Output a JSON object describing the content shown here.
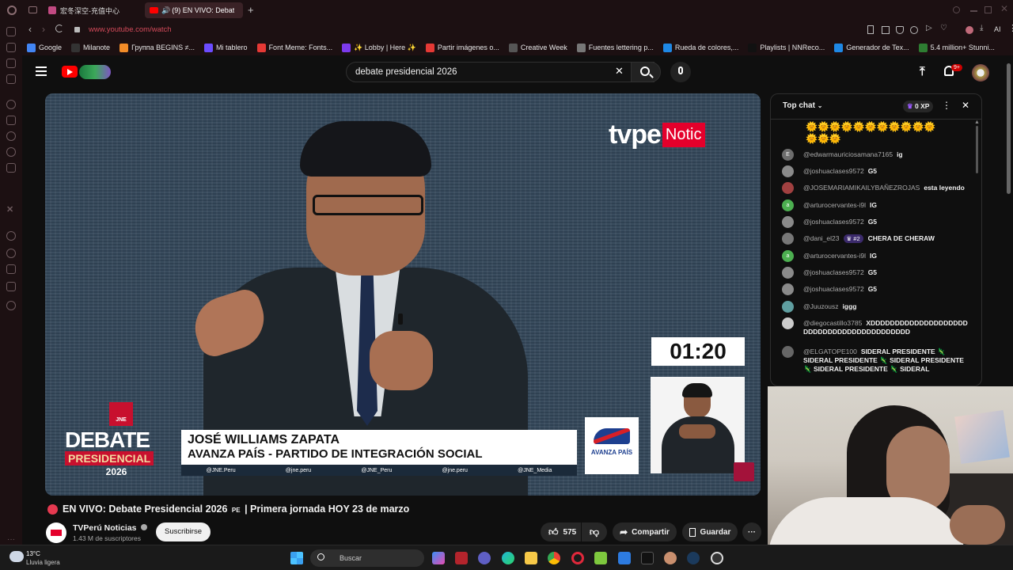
{
  "browser": {
    "tabs": [
      {
        "label": "宏冬深空-充值中心"
      },
      {
        "label": "(9)  EN VIVO: Debat"
      }
    ],
    "new_tab": "+",
    "address": "www.youtube.com/watch",
    "ai_label": "AI",
    "bookmarks": [
      {
        "label": "Google",
        "color": "#4285f4"
      },
      {
        "label": "Milanote",
        "color": "#333333"
      },
      {
        "label": "Группа BEGINS ≠...",
        "color": "#f28c28"
      },
      {
        "label": "Mi tablero",
        "color": "#6b4cff"
      },
      {
        "label": "Font Meme: Fonts...",
        "color": "#e53935"
      },
      {
        "label": "✨ Lobby | Here ✨",
        "color": "#7c3aed"
      },
      {
        "label": "Partir imágenes o...",
        "color": "#e53935"
      },
      {
        "label": "Creative Week",
        "color": "#555555"
      },
      {
        "label": "Fuentes lettering p...",
        "color": "#777777"
      },
      {
        "label": "Rueda de colores,...",
        "color": "#1e88e5"
      },
      {
        "label": "Playlists | NNReco...",
        "color": "#111111"
      },
      {
        "label": "Generador de Tex...",
        "color": "#1e88e5"
      },
      {
        "label": "5.4 million+ Stunni...",
        "color": "#2e7d32"
      }
    ]
  },
  "youtube": {
    "search_value": "debate presidencial 2026",
    "notifications_badge": "9+",
    "video": {
      "channel_logo_text": "tvpe",
      "channel_logo_suffix": "Notic",
      "timer": "01:20",
      "debate_label_top": "DEBATE",
      "debate_label_mid": "PRESIDENCIAL",
      "debate_label_year": "2026",
      "jne_label": "JNE",
      "speaker_name": "JOSÉ WILLIAMS ZAPATA",
      "speaker_party": "AVANZA PAÍS - PARTIDO DE INTEGRACIÓN SOCIAL",
      "party_logo_text": "AVANZA PAÍS",
      "socials": [
        "@JNE.Peru",
        "@jne.peru",
        "@JNE_Peru",
        "@jne.peru",
        "@JNE_Media"
      ]
    },
    "title_prefix": "EN VIVO: Debate Presidencial 2026",
    "title_flag": "PE",
    "title_suffix": "| Primera jornada HOY 23 de marzo",
    "channel_name": "TVPerú Noticias",
    "subscribers": "1.43 M de suscriptores",
    "subscribe_label": "Suscribirse",
    "likes": "575",
    "share_label": "Compartir",
    "save_label": "Guardar",
    "chat": {
      "header": "Top chat",
      "xp": "0 XP",
      "emoji_row_1": "🌞🌞🌞🌞🌞🌞🌞🌞🌞🌞🌞",
      "emoji_row_2": "🌞🌞🌞",
      "badge_rank": "#2",
      "messages": [
        {
          "author": "@edwarmauriciosamana7165",
          "text": "ig",
          "avatar_letter": "E",
          "color": "#6d6d6d"
        },
        {
          "author": "@joshuaclases9572",
          "text": "G5",
          "avatar_letter": "",
          "color": "#8a8a8a"
        },
        {
          "author": "@JOSEMARIAMIKAILYBAÑEZROJAS",
          "text": "esta leyendo",
          "avatar_letter": "",
          "color": "#a04040"
        },
        {
          "author": "@arturocervantes-i9l",
          "text": "IG",
          "avatar_letter": "a",
          "color": "#4caf50"
        },
        {
          "author": "@joshuaclases9572",
          "text": "G5",
          "avatar_letter": "",
          "color": "#8a8a8a"
        },
        {
          "author": "@dani_el23",
          "text": "CHERA DE CHERAW",
          "avatar_letter": "",
          "color": "#777777"
        },
        {
          "author": "@arturocervantes-i9l",
          "text": "IG",
          "avatar_letter": "a",
          "color": "#4caf50"
        },
        {
          "author": "@joshuaclases9572",
          "text": "G5",
          "avatar_letter": "",
          "color": "#8a8a8a"
        },
        {
          "author": "@joshuaclases9572",
          "text": "G5",
          "avatar_letter": "",
          "color": "#8a8a8a"
        },
        {
          "author": "@Juuzousz",
          "text": "iggg",
          "avatar_letter": "",
          "color": "#5f9ea0"
        },
        {
          "author": "@diegocastillo3785",
          "text": "XDDDDDDDDDDDDDDDDDDDDDDDDDDDDDDDDDDDDDDDDDD",
          "avatar_letter": "",
          "color": "#cccccc"
        },
        {
          "author": "@ELGATOPE100",
          "text": "SIDERAL PRESIDENTE 🦎 SIDERAL PRESIDENTE 🦎 SIDERAL PRESIDENTE 🦎 SIDERAL PRESIDENTE 🦎 SIDERAL",
          "avatar_letter": "",
          "color": "#666666"
        }
      ]
    }
  },
  "taskbar": {
    "temperature": "13°C",
    "weather": "Lluvia ligera",
    "search_placeholder": "Buscar"
  },
  "colors": {
    "yt_red": "#ff0000",
    "tvpe_red": "#e4002b",
    "jne_red": "#c8102e"
  }
}
